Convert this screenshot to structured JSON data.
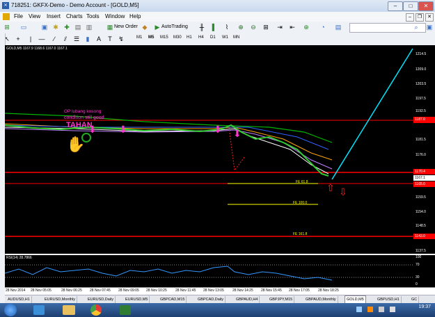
{
  "window": {
    "title": "718251: GKFX-Demo - Demo Account - [GOLD,M5]"
  },
  "menu": [
    "File",
    "View",
    "Insert",
    "Charts",
    "Tools",
    "Window",
    "Help"
  ],
  "toolbar": {
    "new_order": "New Order",
    "autotrading": "AutoTrading",
    "timeframes": [
      "M1",
      "M5",
      "M15",
      "M30",
      "H1",
      "H4",
      "D1",
      "W1",
      "MN"
    ],
    "search_placeholder": ""
  },
  "chart": {
    "symbol_label": "GOLD,M5  1167.9 1168.6 1167.0 1167.1",
    "annotations": {
      "op": "OP lubang kosong",
      "condition": "condition still good",
      "tahan": "TAHAN",
      "fe618": "FE 61.8",
      "fe100": "FE 100.0",
      "fe1618": "FE 161.8"
    },
    "y_ticks": [
      "1214.5",
      "1209.0",
      "1203.5",
      "1197.5",
      "1192.5",
      "1187.0",
      "1181.5",
      "1176.0",
      "1170.5",
      "1165.0",
      "1159.5",
      "1154.0",
      "1148.5",
      "1143.0",
      "1137.5"
    ],
    "price_tags": [
      "1187.0",
      "1170.4",
      "1167.1",
      "1165.0",
      "1143.0"
    ],
    "colors": {
      "background": "#000000",
      "hline": "#ff0000",
      "trend": "#00e5ff",
      "fe": "#ffff00",
      "annot": "#ff33cc"
    }
  },
  "rsi": {
    "label": "RSI(14) 28.7866",
    "ticks": [
      "100",
      "70",
      "30",
      "0"
    ]
  },
  "x_axis": [
    "28 Nov 2014",
    "28 Nov 05:05",
    "28 Nov 06:25",
    "28 Nov 07:45",
    "28 Nov 09:05",
    "28 Nov 10:25",
    "28 Nov 11:45",
    "28 Nov 13:05",
    "28 Nov 14:25",
    "28 Nov 15:45",
    "28 Nov 17:05",
    "28 Nov 18:25"
  ],
  "tabs": [
    "AUDUSD,H1",
    "EURUSD,Monthly",
    "EURUSD,Daily",
    "EURUSD,M5",
    "GBPCAD,M15",
    "GBPCAD,Daily",
    "GBPAUD,H4",
    "GBPJPY,M15",
    "GBPAUD,Monthly",
    "GOLD,M5",
    "GBPUSD,H1",
    "GC"
  ],
  "active_tab": "GOLD,M5",
  "clock": "19:37"
}
